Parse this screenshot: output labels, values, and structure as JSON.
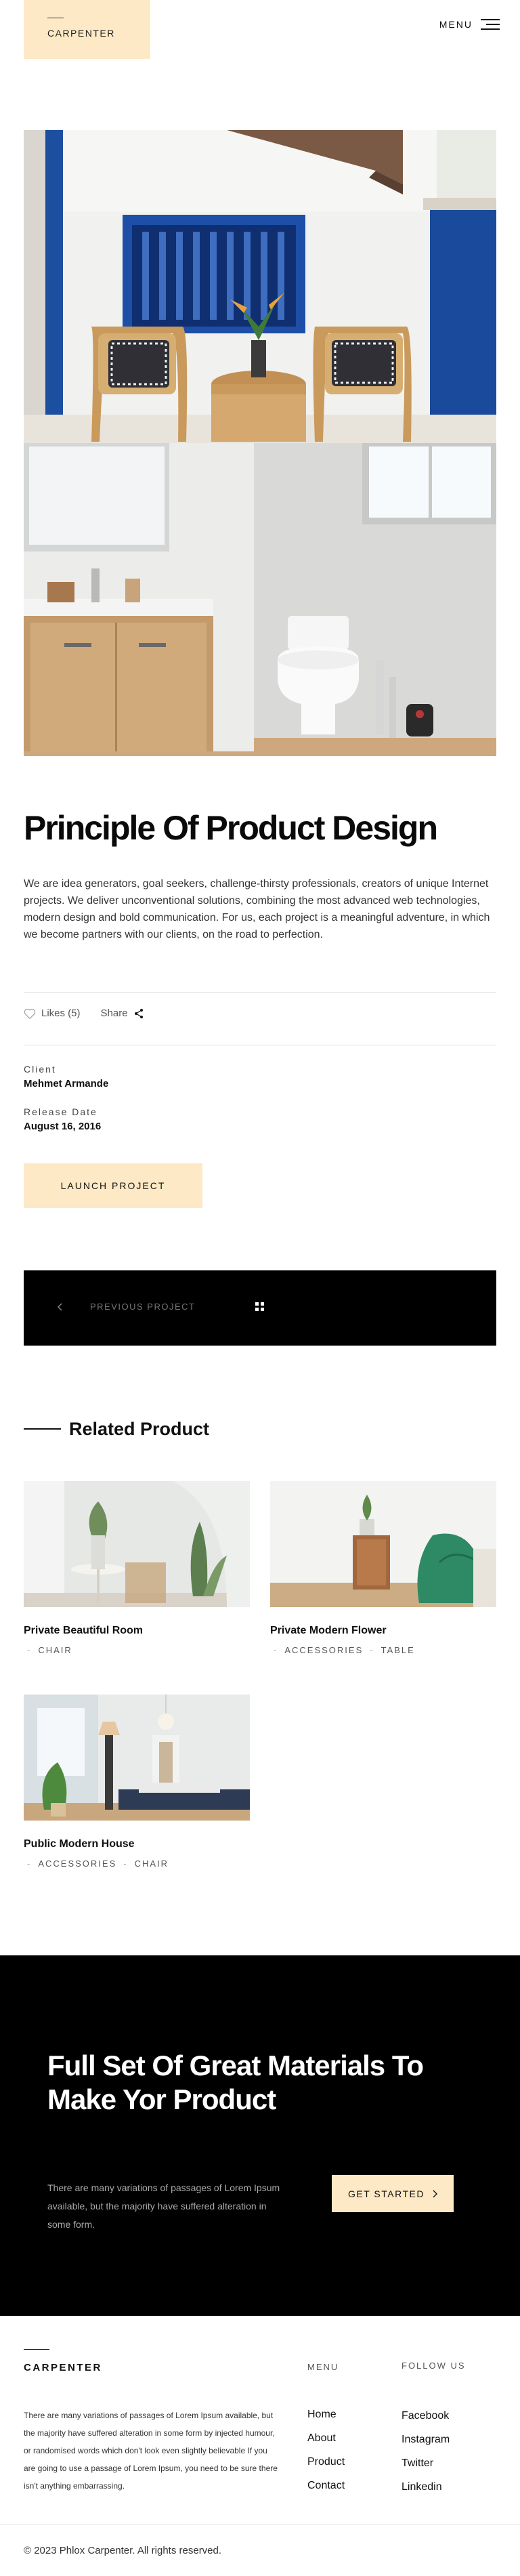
{
  "header": {
    "logo": "CARPENTER",
    "menu_label": "MENU"
  },
  "project": {
    "title": "Principle Of Product Design",
    "description": "We are idea generators, goal seekers, challenge-thirsty professionals, creators of unique Internet projects. We deliver unconventional solutions, combining the most advanced web technologies, modern design and bold communication. For us, each project is a meaningful adventure, in which we become partners with our clients, on the road to perfection.",
    "likes_label": "Likes (5)",
    "share_label": "Share",
    "client_label": "Client",
    "client_value": "Mehmet Armande",
    "release_label": "Release Date",
    "release_value": "August 16, 2016",
    "launch_button": "LAUNCH PROJECT"
  },
  "project_nav": {
    "prev_label": "PREVIOUS PROJECT"
  },
  "related": {
    "title": "Related Product",
    "items": [
      {
        "name": "Private Beautiful Room",
        "tags": [
          "CHAIR"
        ]
      },
      {
        "name": "Private Modern Flower",
        "tags": [
          "ACCESSORIES",
          "TABLE"
        ]
      },
      {
        "name": "Public Modern House",
        "tags": [
          "ACCESSORIES",
          "CHAIR"
        ]
      }
    ]
  },
  "cta": {
    "heading": "Full Set Of Great Materials To Make Yor Product",
    "text": "There are many variations of passages of Lorem Ipsum available, but the majority have suffered alteration in some form.",
    "button": "GET STARTED"
  },
  "footer": {
    "brand": "CARPENTER",
    "text": "There are many variations of passages of Lorem Ipsum available, but the majority have suffered alteration in some form by injected humour, or randomised words which don't look even slightly believable If you are going to use a passage of Lorem Ipsum, you need to be sure there isn't anything embarrassing.",
    "menu_title": "MENU",
    "menu_links": [
      "Home",
      "About",
      "Product",
      "Contact"
    ],
    "follow_title": "FOLLOW US",
    "follow_links": [
      "Facebook",
      "Instagram",
      "Twitter",
      "Linkedin"
    ],
    "copyright": "© 2023 Phlox Carpenter. All rights reserved."
  },
  "colors": {
    "accent": "#fde9c5",
    "dark": "#000000"
  },
  "icons": [
    "hamburger-icon",
    "heart-icon",
    "share-icon",
    "chevron-left-icon",
    "grid-icon",
    "chevron-right-icon"
  ]
}
